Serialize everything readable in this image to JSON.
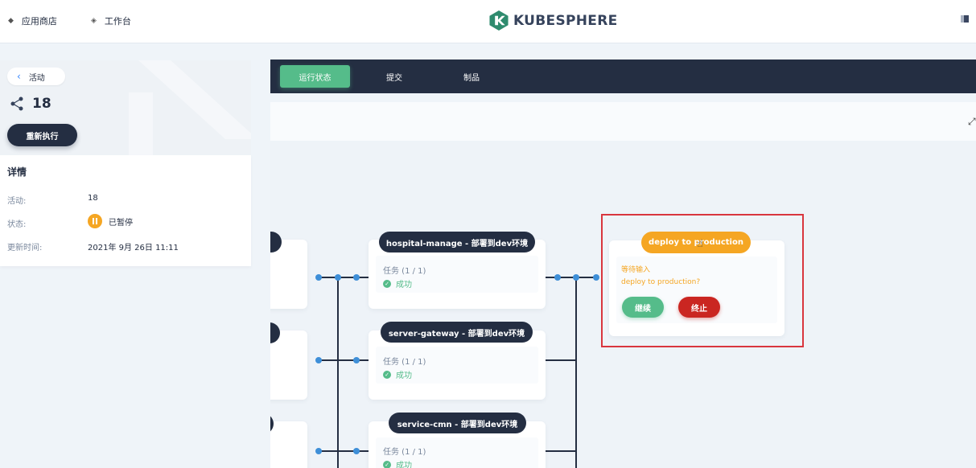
{
  "topbar": {
    "app_store": "应用商店",
    "workbench": "工作台",
    "logo_text": "KUBESPHERE"
  },
  "left": {
    "back_label": "活动",
    "run_number": "18",
    "rerun_label": "重新执行",
    "details_title": "详情",
    "rows": [
      {
        "label": "活动:",
        "value": "18"
      },
      {
        "label": "状态:",
        "value": "已暂停"
      },
      {
        "label": "更新时间:",
        "value": "2021年 9月 26日 11:11"
      }
    ]
  },
  "tabs": [
    {
      "label": "运行状态",
      "active": true
    },
    {
      "label": "提交",
      "active": false
    },
    {
      "label": "制品",
      "active": false
    }
  ],
  "stages": [
    {
      "title": "hospital-manage - 部署到dev环境",
      "task": "任务 (1 / 1)",
      "status": "成功"
    },
    {
      "title": "server-gateway - 部署到dev环境",
      "task": "任务 (1 / 1)",
      "status": "成功"
    },
    {
      "title": "service-cmn - 部署到dev环境",
      "task": "任务 (1 / 1)",
      "status": "成功"
    }
  ],
  "deploy": {
    "title": "deploy to production",
    "waiting": "等待输入",
    "question": "deploy to production?",
    "continue_label": "继续",
    "abort_label": "终止"
  },
  "colors": {
    "dark": "#242e42",
    "green": "#55bc8a",
    "orange": "#f5a623",
    "red": "#ca2621",
    "connector_blue": "#3e8fd8",
    "highlight_border": "#d9363e"
  }
}
